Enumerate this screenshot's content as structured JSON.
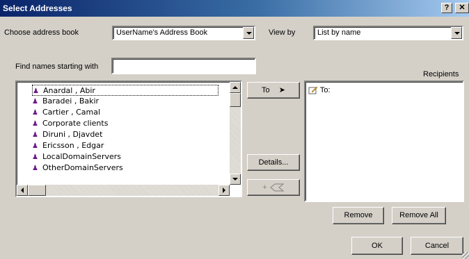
{
  "window": {
    "title": "Select Addresses",
    "help_label": "?",
    "close_label": "✕"
  },
  "address_book": {
    "label": "Choose address book",
    "selected": "UserName's Address Book"
  },
  "view_by": {
    "label": "View by",
    "selected": "List by name"
  },
  "find": {
    "label": "Find names starting with",
    "value": ""
  },
  "recipients": {
    "label": "Recipients",
    "to_label": "To:"
  },
  "names": [
    {
      "name": "Anardal , Abir",
      "type": "user-icon"
    },
    {
      "name": "Baradei , Bakir",
      "type": "user-icon"
    },
    {
      "name": "Cartier , Camal",
      "type": "user-icon"
    },
    {
      "name": "Corporate clients",
      "type": "group-icon"
    },
    {
      "name": "Diruni , Djavdet",
      "type": "user-icon"
    },
    {
      "name": "Ericsson , Edgar",
      "type": "user-icon"
    },
    {
      "name": "LocalDomainServers",
      "type": "group-icon"
    },
    {
      "name": "OtherDomainServers",
      "type": "group-icon"
    }
  ],
  "buttons": {
    "to": "To",
    "details": "Details...",
    "add_contact": "+",
    "remove": "Remove",
    "remove_all": "Remove All",
    "ok": "OK",
    "cancel": "Cancel"
  }
}
